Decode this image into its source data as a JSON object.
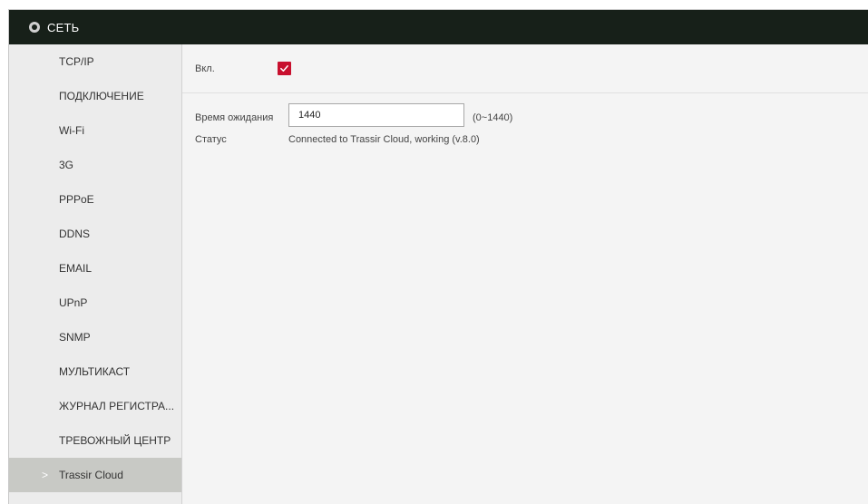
{
  "header": {
    "title": "СЕТЬ",
    "icon": "globe-icon"
  },
  "sidebar": {
    "items": [
      {
        "label": "TCP/IP"
      },
      {
        "label": "ПОДКЛЮЧЕНИЕ"
      },
      {
        "label": "Wi-Fi"
      },
      {
        "label": "3G"
      },
      {
        "label": "PPPoE"
      },
      {
        "label": "DDNS"
      },
      {
        "label": "EMAIL"
      },
      {
        "label": "UPnP"
      },
      {
        "label": "SNMP"
      },
      {
        "label": "МУЛЬТИКАСТ"
      },
      {
        "label": "ЖУРНАЛ РЕГИСТРА..."
      },
      {
        "label": "ТРЕВОЖНЫЙ ЦЕНТР"
      },
      {
        "label": "Trassir Cloud",
        "active": true,
        "indicator": ">"
      }
    ]
  },
  "form": {
    "enable_label": "Вкл.",
    "enable_checked": true,
    "timeout_label": "Время ожидания",
    "timeout_value": "1440",
    "timeout_range": "(0~1440)",
    "status_label": "Статус",
    "status_value": "Connected to Trassir Cloud, working (v.8.0)"
  },
  "colors": {
    "titlebar": "#172019",
    "accent": "#c8102e",
    "active_item": "#c8c9c5"
  }
}
